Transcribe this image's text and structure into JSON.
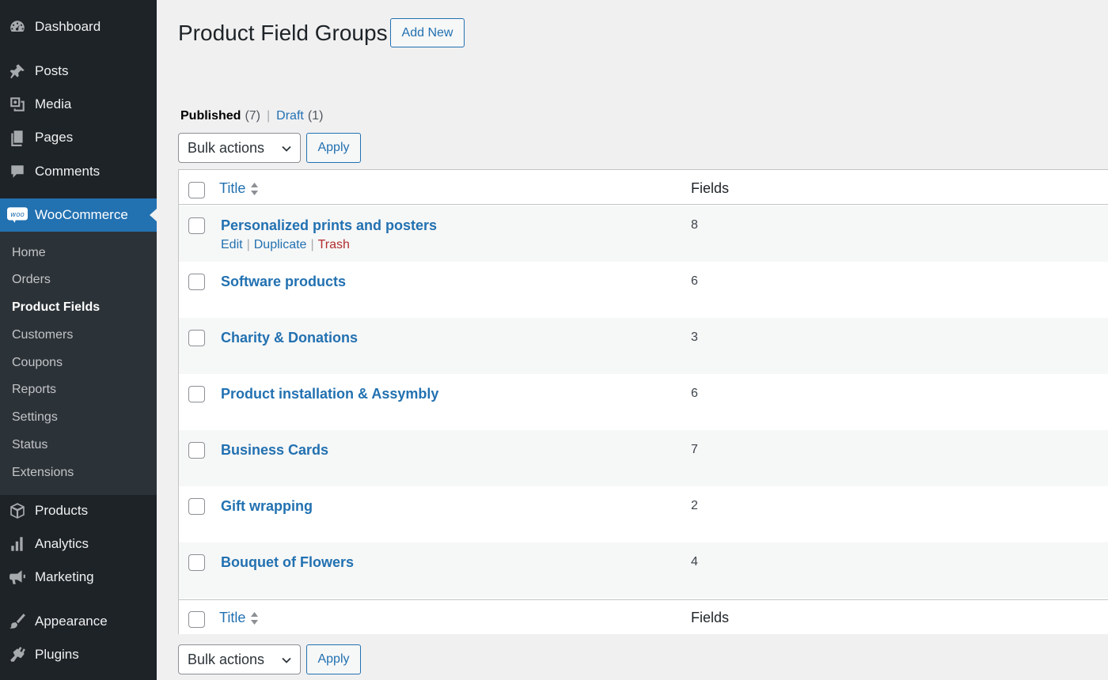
{
  "sidebar": {
    "top_items": [
      {
        "label": "Dashboard",
        "icon": "dashboard-icon"
      },
      {
        "label": "Posts",
        "icon": "pin-icon"
      },
      {
        "label": "Media",
        "icon": "media-icon"
      },
      {
        "label": "Pages",
        "icon": "pages-icon"
      },
      {
        "label": "Comments",
        "icon": "comment-icon"
      }
    ],
    "woocommerce": {
      "label": "WooCommerce",
      "logo_text": "woo"
    },
    "submenu": [
      "Home",
      "Orders",
      "Product Fields",
      "Customers",
      "Coupons",
      "Reports",
      "Settings",
      "Status",
      "Extensions"
    ],
    "current_submenu": "Product Fields",
    "bottom_items": [
      {
        "label": "Products",
        "icon": "box-icon"
      },
      {
        "label": "Analytics",
        "icon": "bar-chart-icon"
      },
      {
        "label": "Marketing",
        "icon": "megaphone-icon"
      },
      {
        "label": "Appearance",
        "icon": "brush-icon"
      },
      {
        "label": "Plugins",
        "icon": "plug-icon"
      }
    ]
  },
  "header": {
    "title": "Product Field Groups",
    "add_new_label": "Add New"
  },
  "filters": {
    "published_label": "Published",
    "published_count": "(7)",
    "separator": "|",
    "draft_label": "Draft",
    "draft_count": "(1)"
  },
  "bulk": {
    "select_label": "Bulk actions",
    "apply_label": "Apply"
  },
  "table": {
    "col_title": "Title",
    "col_fields": "Fields",
    "row_actions": {
      "edit": "Edit",
      "duplicate": "Duplicate",
      "trash": "Trash",
      "sep": "|"
    },
    "rows": [
      {
        "title": "Personalized prints and posters",
        "fields": "8"
      },
      {
        "title": "Software products",
        "fields": "6"
      },
      {
        "title": "Charity & Donations",
        "fields": "3"
      },
      {
        "title": "Product installation & Assymbly",
        "fields": "6"
      },
      {
        "title": "Business Cards",
        "fields": "7"
      },
      {
        "title": "Gift wrapping",
        "fields": "2"
      },
      {
        "title": "Bouquet of Flowers",
        "fields": "4"
      }
    ]
  },
  "colors": {
    "sidebar_bg": "#1d2327",
    "submenu_bg": "#2c3338",
    "accent": "#2271b1",
    "trash": "#b32d2e",
    "page_bg": "#f0f0f1"
  }
}
